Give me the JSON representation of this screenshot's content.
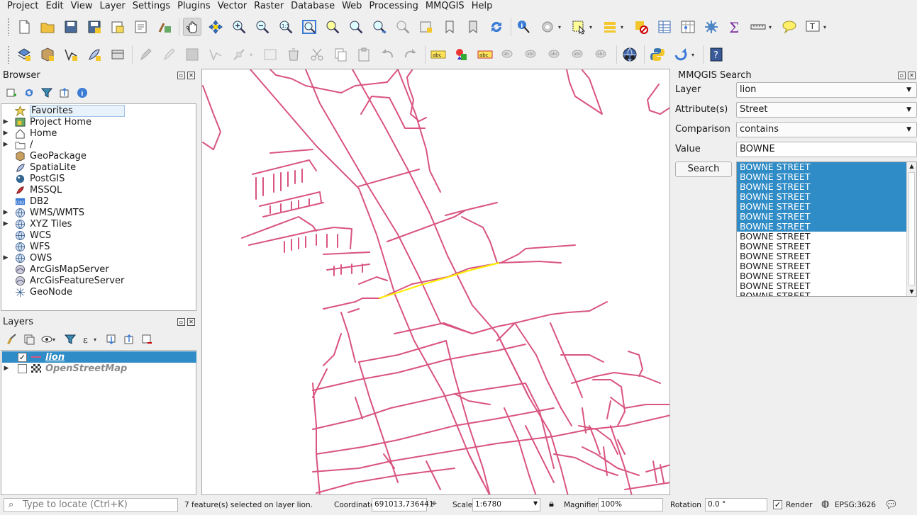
{
  "menu": [
    "Project",
    "Edit",
    "View",
    "Layer",
    "Settings",
    "Plugins",
    "Vector",
    "Raster",
    "Database",
    "Web",
    "Processing",
    "MMQGIS",
    "Help"
  ],
  "browser": {
    "title": "Browser",
    "items": [
      {
        "label": "Favorites",
        "icon": "star-icon",
        "expandable": false
      },
      {
        "label": "Project Home",
        "icon": "project-home-icon",
        "expandable": true
      },
      {
        "label": "Home",
        "icon": "home-icon",
        "expandable": true
      },
      {
        "label": "/",
        "icon": "folder-icon",
        "expandable": true
      },
      {
        "label": "GeoPackage",
        "icon": "geopackage-icon",
        "expandable": false
      },
      {
        "label": "SpatiaLite",
        "icon": "spatialite-icon",
        "expandable": false
      },
      {
        "label": "PostGIS",
        "icon": "postgis-icon",
        "expandable": false
      },
      {
        "label": "MSSQL",
        "icon": "mssql-icon",
        "expandable": false
      },
      {
        "label": "DB2",
        "icon": "db2-icon",
        "expandable": false
      },
      {
        "label": "WMS/WMTS",
        "icon": "globe-icon",
        "expandable": true
      },
      {
        "label": "XYZ Tiles",
        "icon": "globe-icon",
        "expandable": true
      },
      {
        "label": "WCS",
        "icon": "globe-icon",
        "expandable": false
      },
      {
        "label": "WFS",
        "icon": "globe-icon",
        "expandable": false
      },
      {
        "label": "OWS",
        "icon": "globe-icon",
        "expandable": true
      },
      {
        "label": "ArcGisMapServer",
        "icon": "arcgis-icon",
        "expandable": false
      },
      {
        "label": "ArcGisFeatureServer",
        "icon": "arcgis-icon",
        "expandable": false
      },
      {
        "label": "GeoNode",
        "icon": "geonode-icon",
        "expandable": false
      }
    ]
  },
  "layers": {
    "title": "Layers",
    "items": [
      {
        "label": "lion",
        "checked": true,
        "selected": true
      },
      {
        "label": "OpenStreetMap",
        "checked": false,
        "selected": false
      }
    ]
  },
  "mmqgis": {
    "title": "MMQGIS Search",
    "layer_label": "Layer",
    "layer_value": "lion",
    "attribute_label": "Attribute(s)",
    "attribute_value": "Street",
    "comparison_label": "Comparison",
    "comparison_value": "contains",
    "value_label": "Value",
    "value_value": "BOWNE",
    "search_label": "Search",
    "results": [
      {
        "text": "BOWNE STREET",
        "selected": true
      },
      {
        "text": "BOWNE STREET",
        "selected": true
      },
      {
        "text": "BOWNE STREET",
        "selected": true
      },
      {
        "text": "BOWNE STREET",
        "selected": true
      },
      {
        "text": "BOWNE STREET",
        "selected": true
      },
      {
        "text": "BOWNE STREET",
        "selected": true
      },
      {
        "text": "BOWNE STREET",
        "selected": true
      },
      {
        "text": "BOWNE STREET",
        "selected": false
      },
      {
        "text": "BOWNE STREET",
        "selected": false
      },
      {
        "text": "BOWNE STREET",
        "selected": false
      },
      {
        "text": "BOWNE STREET",
        "selected": false
      },
      {
        "text": "BOWNE STREET",
        "selected": false
      },
      {
        "text": "BOWNE STREET",
        "selected": false
      },
      {
        "text": "BOWNE STREET",
        "selected": false
      }
    ]
  },
  "status": {
    "locator_placeholder": "Type to locate (Ctrl+K)",
    "message": "7 feature(s) selected on layer lion.",
    "coordinate_label": "Coordinate",
    "coordinate_value": "691013,736441",
    "scale_label": "Scale",
    "scale_value": "1:6780",
    "magnifier_label": "Magnifier",
    "magnifier_value": "100%",
    "rotation_label": "Rotation",
    "rotation_value": "0.0 °",
    "render_label": "Render",
    "crs": "EPSG:3626"
  },
  "colors": {
    "street_line": "#d9547f",
    "selected_line": "#ffee00",
    "selection_blue": "#308cc6"
  }
}
